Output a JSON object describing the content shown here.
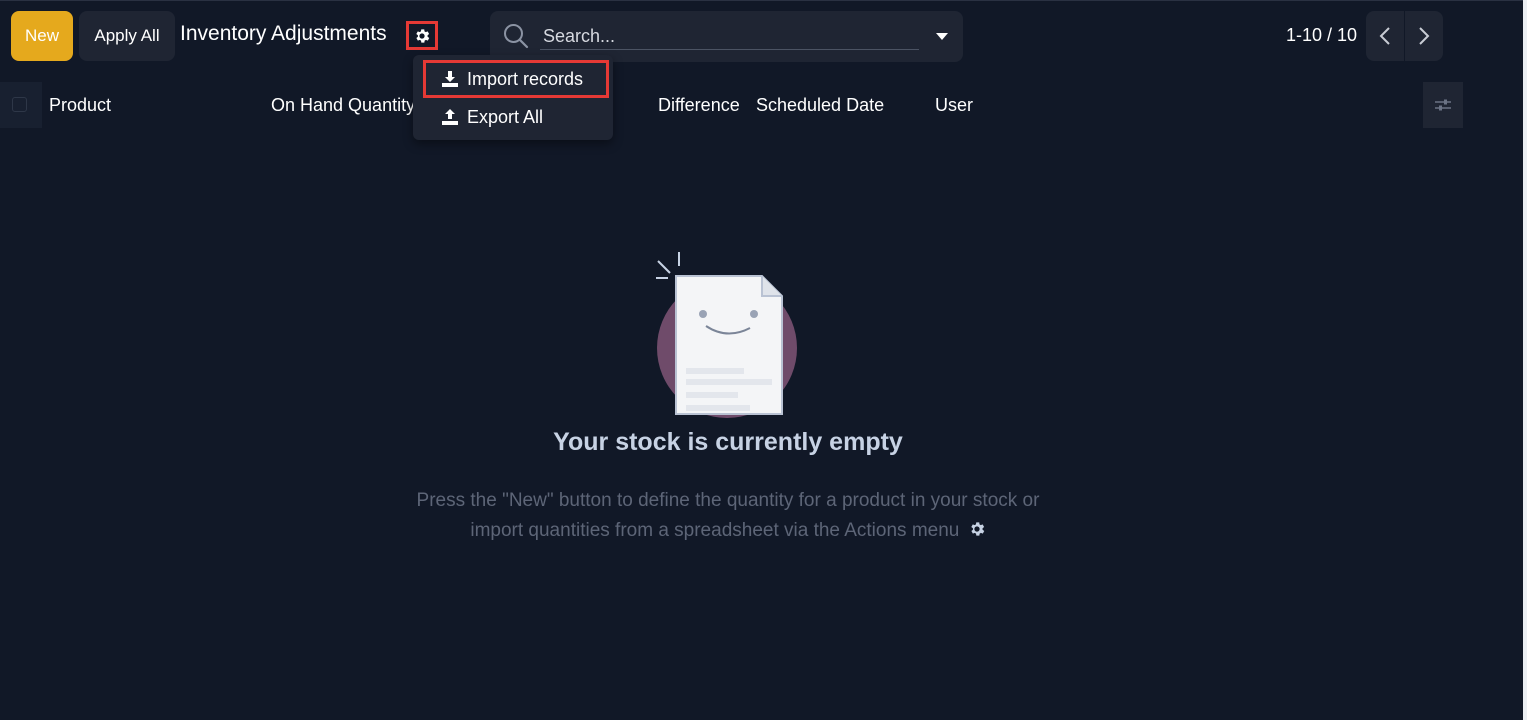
{
  "control_panel": {
    "new_label": "New",
    "apply_all_label": "Apply All",
    "title": "Inventory Adjustments",
    "actions_icon": "gear-icon",
    "search_placeholder": "Search...",
    "search_toggle_icon": "caret-down-icon",
    "pager_value": "1-10 / 10",
    "pager_prev_icon": "chevron-left-icon",
    "pager_next_icon": "chevron-right-icon"
  },
  "actions_menu": {
    "items": [
      {
        "label": "Import records",
        "icon": "download-icon",
        "highlighted": true
      },
      {
        "label": "Export All",
        "icon": "upload-icon",
        "highlighted": false
      }
    ]
  },
  "list": {
    "columns": [
      {
        "label": "Product"
      },
      {
        "label": "On Hand Quantity"
      },
      {
        "label": "Difference"
      },
      {
        "label": "Scheduled Date"
      },
      {
        "label": "User"
      }
    ],
    "optional_columns_icon": "sliders-icon"
  },
  "empty_state": {
    "title": "Your stock is currently empty",
    "help_line_1": "Press the \"New\" button to define the quantity for a product in your stock or",
    "help_line_2": "import quantities from a spreadsheet via the Actions menu",
    "illustration_icon": "smiling-document-icon"
  },
  "colors": {
    "background": "#111827",
    "primary": "#e5a91d",
    "surface": "#1f2533",
    "highlight": "#e53935"
  }
}
